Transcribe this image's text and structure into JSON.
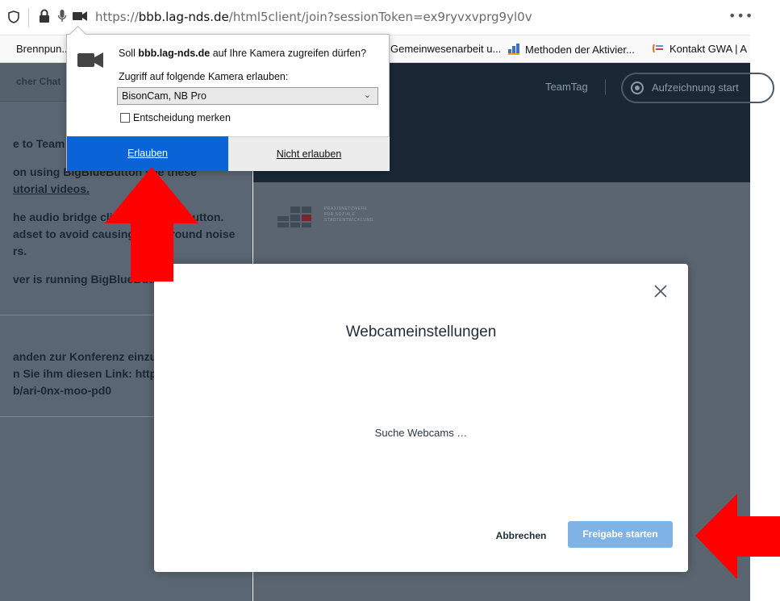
{
  "browser": {
    "url_prefix": "https://",
    "url_host": "bbb.lag-nds.de",
    "url_path": "/html5client/join?sessionToken=ex9ryvxvprg9yl0v",
    "more_label": "•••"
  },
  "bookmarks": [
    {
      "label": "Brennpun..."
    },
    {
      "label": "Gemeinwesenarbeit u..."
    },
    {
      "label": "Methoden der Aktivier..."
    },
    {
      "label": "Kontakt GWA | A"
    }
  ],
  "chat": {
    "title": "cher Chat",
    "lines": [
      "e to Team",
      "on using BigBlueButton see these",
      "utorial videos.",
      "he audio bridge click the phone button.",
      "adset to avoid causing background noise",
      "rs.",
      "ver is running BigBlueButton",
      "anden zur Konferenz einzu",
      "n Sie ihm diesen Link: http",
      "b/ari-0nx-moo-pd0"
    ]
  },
  "topbar": {
    "room_name": "TeamTag",
    "record_label": "Aufzeichnung start"
  },
  "slide": {
    "logo_lines": [
      "PRAXISNETZWERK",
      "FÜR SOZIALE",
      "STADTENTWICKLUNG"
    ]
  },
  "permission": {
    "question_prefix": "Soll ",
    "question_host": "bbb.lag-nds.de",
    "question_suffix": " auf Ihre Kamera zugreifen dürfen?",
    "select_label": "Zugriff auf folgende Kamera erlauben:",
    "selected_camera": "BisonCam, NB Pro",
    "remember_label": "Entscheidung merken",
    "remember_checked": false,
    "allow_label": "Erlauben",
    "deny_label": "Nicht erlauben"
  },
  "modal": {
    "title": "Webcameinstellungen",
    "status": "Suche Webcams …",
    "cancel_label": "Abbrechen",
    "share_label": "Freigabe starten"
  },
  "colors": {
    "allow_blue": "#0a64d8",
    "share_button": "#7fb3e6",
    "annotation_red": "#ff0000",
    "topbar_dark": "#1a2836",
    "sidebar_gray": "#5a6673"
  }
}
